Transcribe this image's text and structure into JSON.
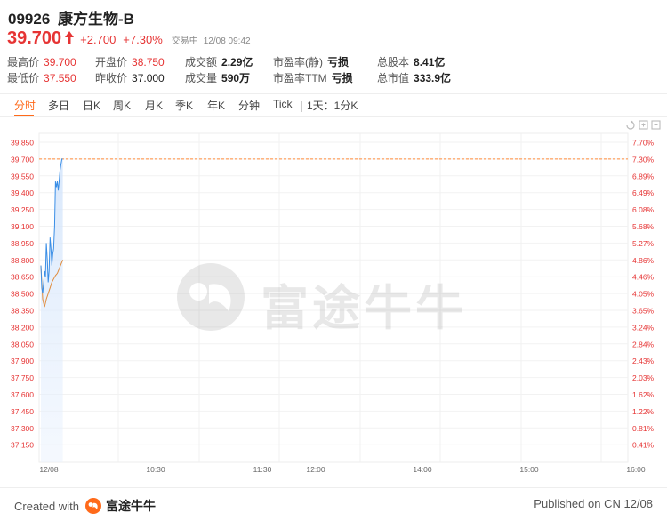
{
  "stock": {
    "code": "09926",
    "name": "康方生物-B",
    "price": "39.700",
    "change": "+2.700",
    "change_pct": "+7.30%",
    "status": "交易中",
    "time": "12/08 09:42"
  },
  "stats": [
    {
      "label": "最高价",
      "value": "39.700",
      "color": "red"
    },
    {
      "label": "开盘价",
      "value": "38.750",
      "color": "red"
    },
    {
      "label": "成交额",
      "value": "2.29亿",
      "color": "plain"
    },
    {
      "label": "市盈率(静)",
      "value": "亏损",
      "color": "plain"
    },
    {
      "label": "总股本",
      "value": "8.41亿",
      "color": "plain"
    },
    {
      "label": "最低价",
      "value": "37.550",
      "color": "red"
    },
    {
      "label": "昨收价",
      "value": "37.000",
      "color": "plain-normal"
    },
    {
      "label": "成交量",
      "value": "590万",
      "color": "plain"
    },
    {
      "label": "市盈率TTM",
      "value": "亏损",
      "color": "plain"
    },
    {
      "label": "总市值",
      "value": "333.9亿",
      "color": "plain"
    }
  ],
  "tabs": [
    "分时",
    "多日",
    "日K",
    "周K",
    "月K",
    "季K",
    "年K",
    "分钟",
    "Tick",
    "1天：1分K"
  ],
  "active_tab": "分时",
  "footer": {
    "created_prefix": "Created with",
    "brand": "富途牛牛",
    "published": "Published on CN 12/08"
  },
  "watermark": "富途牛牛",
  "colors": {
    "up": "#e63434",
    "accent": "#ff6a1a",
    "price_line": "#3a8ee6",
    "avg_line": "#e08a3a",
    "prev_close_line": "#ff8a3a"
  },
  "chart_data": {
    "type": "line",
    "y_ticks": [
      "39.850",
      "39.700",
      "39.550",
      "39.400",
      "39.250",
      "39.100",
      "38.950",
      "38.800",
      "38.650",
      "38.500",
      "38.350",
      "38.200",
      "38.050",
      "37.900",
      "37.750",
      "37.600",
      "37.450",
      "37.300",
      "37.150"
    ],
    "pct_ticks": [
      "7.70%",
      "7.30%",
      "6.89%",
      "6.49%",
      "6.08%",
      "5.68%",
      "5.27%",
      "4.86%",
      "4.46%",
      "4.05%",
      "3.65%",
      "3.24%",
      "2.84%",
      "2.43%",
      "2.03%",
      "1.62%",
      "1.22%",
      "0.81%",
      "0.41%"
    ],
    "x_ticks": [
      "12/08",
      "10:30",
      "11:30",
      "12:00",
      "14:00",
      "15:00",
      "16:00"
    ],
    "ylim": [
      37.08,
      39.92
    ],
    "current_price": 39.7,
    "price_series": {
      "name": "",
      "x": [
        0,
        0.5,
        1,
        1.5,
        2,
        2.5,
        3,
        3.5,
        4,
        4.5,
        5,
        5.5,
        6,
        6.5,
        7,
        7.5,
        8,
        8.5,
        9,
        9.5,
        10,
        10.5,
        11,
        11.5,
        12
      ],
      "y": [
        38.75,
        38.55,
        38.5,
        38.6,
        38.7,
        38.65,
        38.95,
        38.8,
        38.6,
        38.7,
        39.0,
        38.9,
        38.75,
        38.85,
        38.9,
        39.1,
        39.5,
        39.45,
        39.5,
        39.42,
        39.5,
        39.6,
        39.65,
        39.7,
        39.7
      ]
    },
    "avg_series": {
      "name": "",
      "x": [
        0,
        1,
        2,
        3,
        4,
        5,
        6,
        7,
        8,
        9,
        10,
        11,
        12
      ],
      "y": [
        38.75,
        38.45,
        38.38,
        38.45,
        38.5,
        38.55,
        38.6,
        38.63,
        38.66,
        38.68,
        38.72,
        38.76,
        38.8
      ]
    }
  }
}
